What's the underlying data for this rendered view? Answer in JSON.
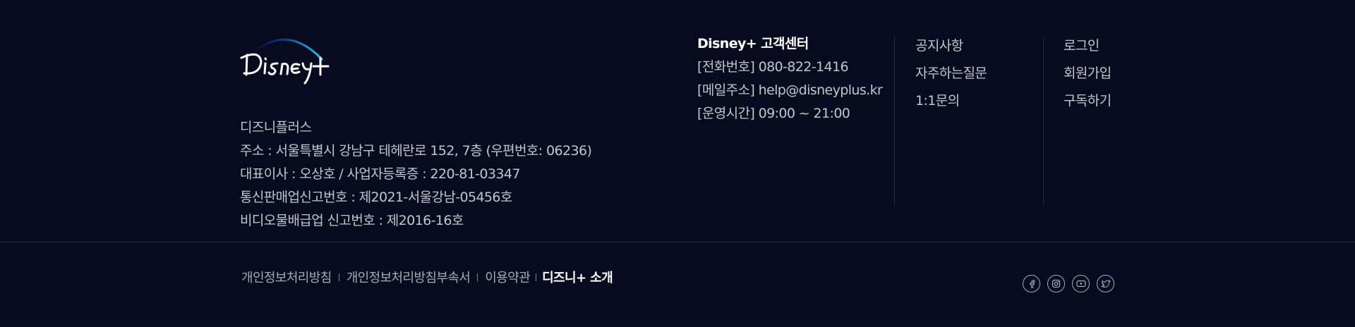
{
  "brand": {
    "logo_text": "Disney+"
  },
  "company": {
    "name": "디즈니플러스",
    "address": "주소 : 서울특별시 강남구 테헤란로 152, 7층 (우편번호: 06236)",
    "ceo": "대표이사 : 오상호 / 사업자등록증 : 220-81-03347",
    "telecom": "통신판매업신고번호 : 제2021-서울강남-05456호",
    "video": "비디오물배급업 신고번호 : 제2016-16호"
  },
  "support": {
    "title": "Disney+ 고객센터",
    "phone": "[전화번호] 080-822-1416",
    "email": "[메일주소] help@disneyplus.kr",
    "hours": "[운영시간] 09:00 ~ 21:00"
  },
  "links_col1": [
    "공지사항",
    "자주하는질문",
    "1:1문의"
  ],
  "links_col2": [
    "로그인",
    "회원가입",
    "구독하기"
  ],
  "bottom_links": [
    "개인정보처리방침",
    "개인정보처리방침부속서",
    "이용약관",
    "디즈니+ 소개"
  ],
  "social": [
    {
      "name": "facebook-icon"
    },
    {
      "name": "instagram-icon"
    },
    {
      "name": "youtube-icon"
    },
    {
      "name": "twitter-icon"
    }
  ],
  "colors": {
    "background": "#080b1f",
    "text": "#c3c5cc",
    "accent_arc": "#1fb6e6"
  }
}
